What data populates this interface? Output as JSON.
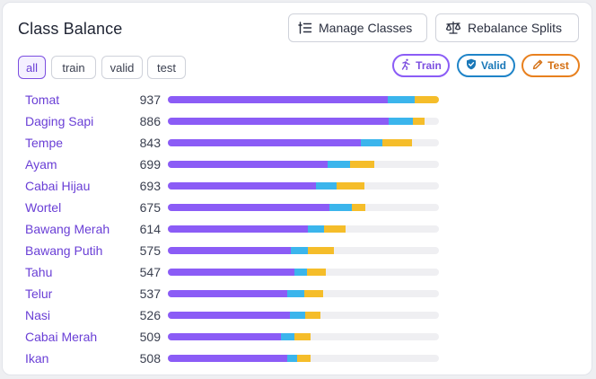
{
  "header": {
    "title": "Class Balance",
    "manage_label": "Manage Classes",
    "rebalance_label": "Rebalance Splits"
  },
  "filters": [
    {
      "label": "all",
      "active": true
    },
    {
      "label": "train",
      "active": false
    },
    {
      "label": "valid",
      "active": false
    },
    {
      "label": "test",
      "active": false
    }
  ],
  "legend": {
    "train": "Train",
    "valid": "Valid",
    "test": "Test"
  },
  "colors": {
    "train": "#8b5cf6",
    "valid": "#3bb5ec",
    "test": "#f5bd2a",
    "track": "#efeff2",
    "accent": "#7c4fe0"
  },
  "icons": {
    "manage": "list-settings-icon",
    "rebalance": "scale-icon",
    "train": "running-person-icon",
    "valid": "shield-check-icon",
    "test": "pencil-icon"
  },
  "max_count": 937,
  "classes": [
    {
      "name": "Tomat",
      "count": 937,
      "train": 0.811,
      "valid": 0.099,
      "test": 0.09
    },
    {
      "name": "Daging Sapi",
      "count": 886,
      "train": 0.862,
      "valid": 0.093,
      "test": 0.045
    },
    {
      "name": "Tempe",
      "count": 843,
      "train": 0.79,
      "valid": 0.09,
      "test": 0.12
    },
    {
      "name": "Ayam",
      "count": 699,
      "train": 0.79,
      "valid": 0.113,
      "test": 0.117
    },
    {
      "name": "Cabai Hijau",
      "count": 693,
      "train": 0.74,
      "valid": 0.1,
      "test": 0.14
    },
    {
      "name": "Wortel",
      "count": 675,
      "train": 0.828,
      "valid": 0.113,
      "test": 0.068
    },
    {
      "name": "Bawang Merah",
      "count": 614,
      "train": 0.79,
      "valid": 0.09,
      "test": 0.12
    },
    {
      "name": "Bawang Putih",
      "count": 575,
      "train": 0.74,
      "valid": 0.1,
      "test": 0.16
    },
    {
      "name": "Tahu",
      "count": 547,
      "train": 0.8,
      "valid": 0.08,
      "test": 0.12
    },
    {
      "name": "Telur",
      "count": 537,
      "train": 0.77,
      "valid": 0.11,
      "test": 0.12
    },
    {
      "name": "Nasi",
      "count": 526,
      "train": 0.8,
      "valid": 0.1,
      "test": 0.1
    },
    {
      "name": "Cabai Merah",
      "count": 509,
      "train": 0.77,
      "valid": 0.09,
      "test": 0.11
    },
    {
      "name": "Ikan",
      "count": 508,
      "train": 0.81,
      "valid": 0.07,
      "test": 0.09
    }
  ]
}
